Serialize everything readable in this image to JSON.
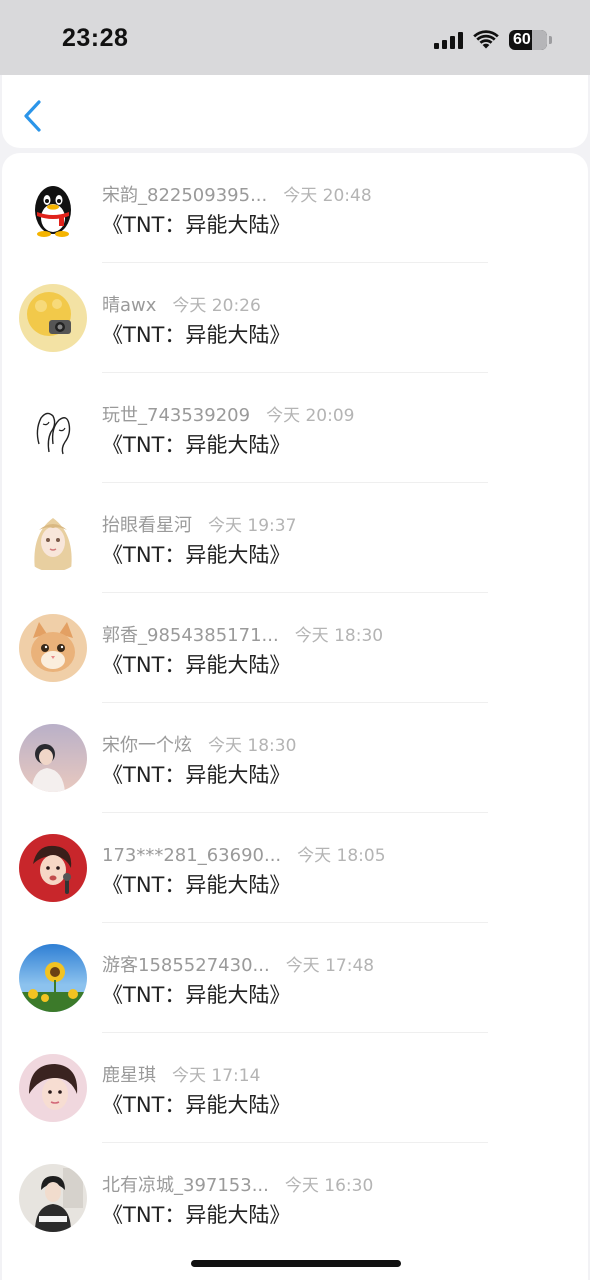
{
  "status_bar": {
    "time": "23:28",
    "battery_level": "60",
    "icons": [
      "signal-icon",
      "wifi-icon",
      "battery-icon"
    ]
  },
  "nav": {
    "back_icon": "chevron-left-icon"
  },
  "colors": {
    "accent": "#2b95e9",
    "name_text": "#9a9a9a",
    "message_text": "#222222"
  },
  "messages": [
    {
      "name": "宋韵_822509395...",
      "time": "今天 20:48",
      "text": "《TNT：异能大陆》",
      "avatar": "qq-penguin"
    },
    {
      "name": "晴awx",
      "time": "今天 20:26",
      "text": "《TNT：异能大陆》",
      "avatar": "yellow-camera"
    },
    {
      "name": "玩世_743539209",
      "time": "今天 20:09",
      "text": "《TNT：异能大陆》",
      "avatar": "sketch-line-art"
    },
    {
      "name": "抬眼看星河",
      "time": "今天 19:37",
      "text": "《TNT：异能大陆》",
      "avatar": "anime-girl"
    },
    {
      "name": "郭香_9854385171...",
      "time": "今天 18:30",
      "text": "《TNT：异能大陆》",
      "avatar": "orange-kitten"
    },
    {
      "name": "宋你一个炫",
      "time": "今天 18:30",
      "text": "《TNT：异能大陆》",
      "avatar": "person-sunset"
    },
    {
      "name": "173***281_63690...",
      "time": "今天 18:05",
      "text": "《TNT：异能大陆》",
      "avatar": "singer-red"
    },
    {
      "name": "游客1585527430...",
      "time": "今天 17:48",
      "text": "《TNT：异能大陆》",
      "avatar": "sunflower-sky"
    },
    {
      "name": "鹿星琪",
      "time": "今天 17:14",
      "text": "《TNT：异能大陆》",
      "avatar": "portrait-pink"
    },
    {
      "name": "北有凉城_397153...",
      "time": "今天 16:30",
      "text": "《TNT：异能大陆》",
      "avatar": "person-sitting"
    }
  ]
}
